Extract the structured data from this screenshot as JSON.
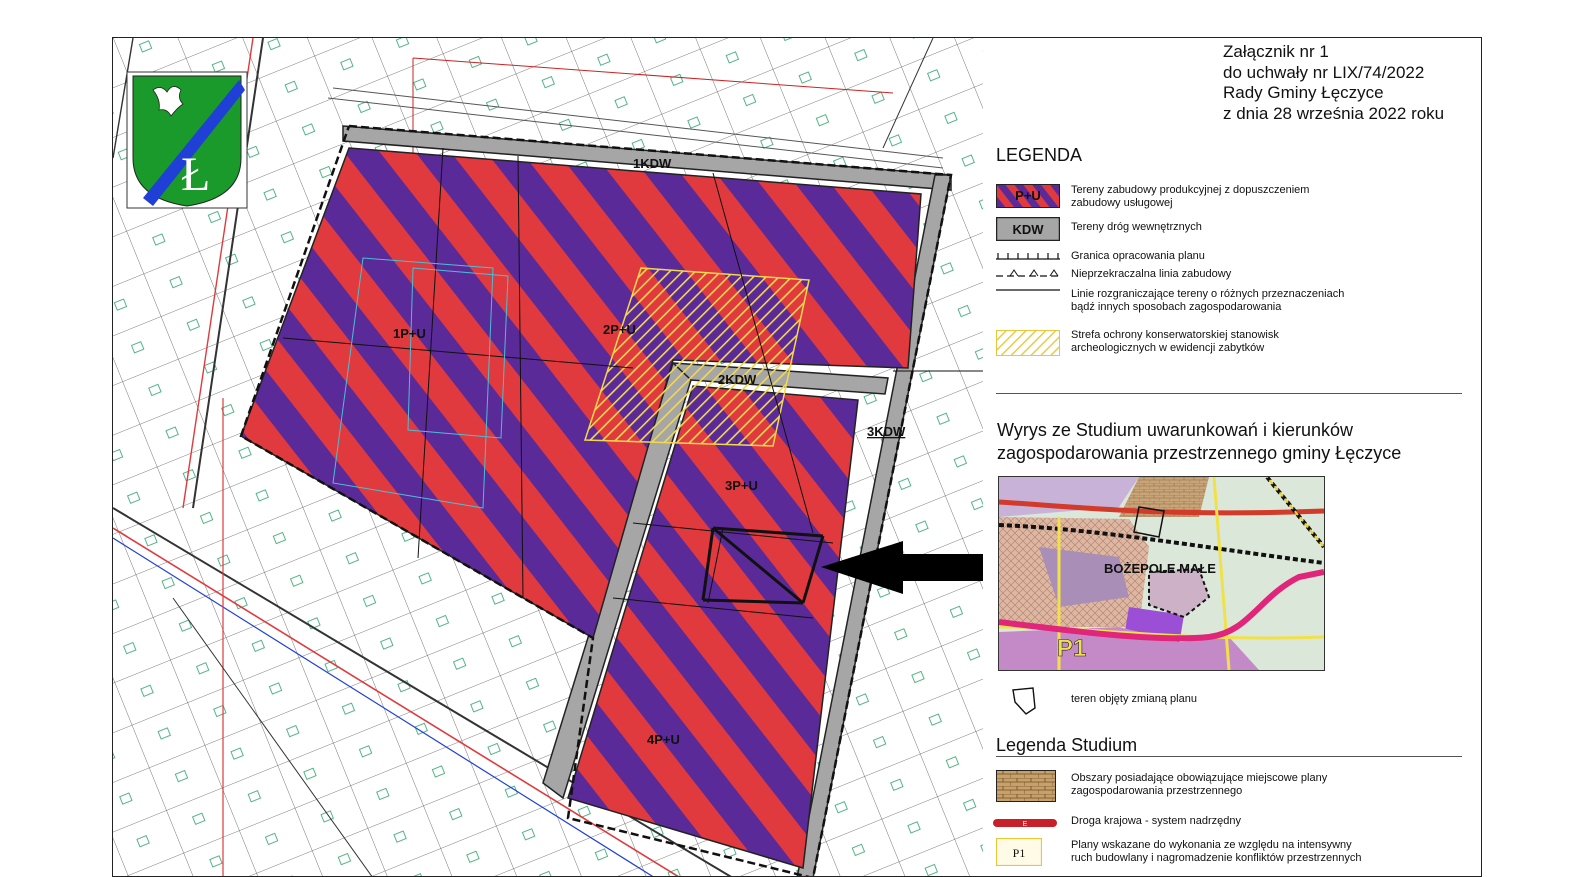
{
  "attachment": {
    "line1": "Załącznik nr 1",
    "line2": "do uchwały nr LIX/74/2022",
    "line3": "Rady Gminy Łęczyce",
    "line4": "z dnia 28 września 2022 roku"
  },
  "legend": {
    "heading": "LEGENDA",
    "pu_symbol": "P+U",
    "pu_text_1": "Tereny zabudowy produkcyjnej z dopuszczeniem",
    "pu_text_2": "zabudowy usługowej",
    "kdw_symbol": "KDW",
    "kdw_text": "Tereny dróg wewnętrznych",
    "boundary_text": "Granica opracowania planu",
    "building_line_text": "Nieprzekraczalna linia zabudowy",
    "division_text_1": "Linie rozgraniczające tereny o  różnych przeznaczeniach",
    "division_text_2": "bądź innych sposobach zagospodarowania",
    "heritage_text_1": "Strefa ochrony konserwatorskiej stanowisk",
    "heritage_text_2": "archeologicznych w ewidencji zabytków"
  },
  "study": {
    "title_1": "Wyrys ze Studium uwarunkowań i kierunków",
    "title_2": "zagospodarowania przestrzennego gminy Łęczyce",
    "village": "BOŻEPOLE MAŁE",
    "plan_label": "P1",
    "plan_area_text": "teren objęty zmianą planu"
  },
  "study_legend": {
    "heading": "Legenda Studium",
    "existing_plans_1": "Obszary posiadające obowiązujące miejscowe plany",
    "existing_plans_2": "zagospodarowania przestrzennego",
    "road_marker": "E",
    "national_road": "Droga krajowa - system nadrzędny",
    "plan_symbol": "P1",
    "plans_text_1": "Plany wskazane do wykonania ze względu na intensywny",
    "plans_text_2": "ruch budowlany i nagromadzenie konfliktów przestrzennych"
  },
  "map": {
    "zones": [
      "1P+U",
      "2P+U",
      "3P+U",
      "4P+U"
    ],
    "roads": [
      "1KDW",
      "2KDW",
      "3KDW"
    ]
  },
  "colors": {
    "zone_red": "#e03a3e",
    "zone_purple": "#5b2a99",
    "road_gray": "#a6a6a6",
    "heritage_yellow": "#f2d94c",
    "crest_green": "#1a9a2a",
    "crest_blue": "#1f3fd6"
  }
}
